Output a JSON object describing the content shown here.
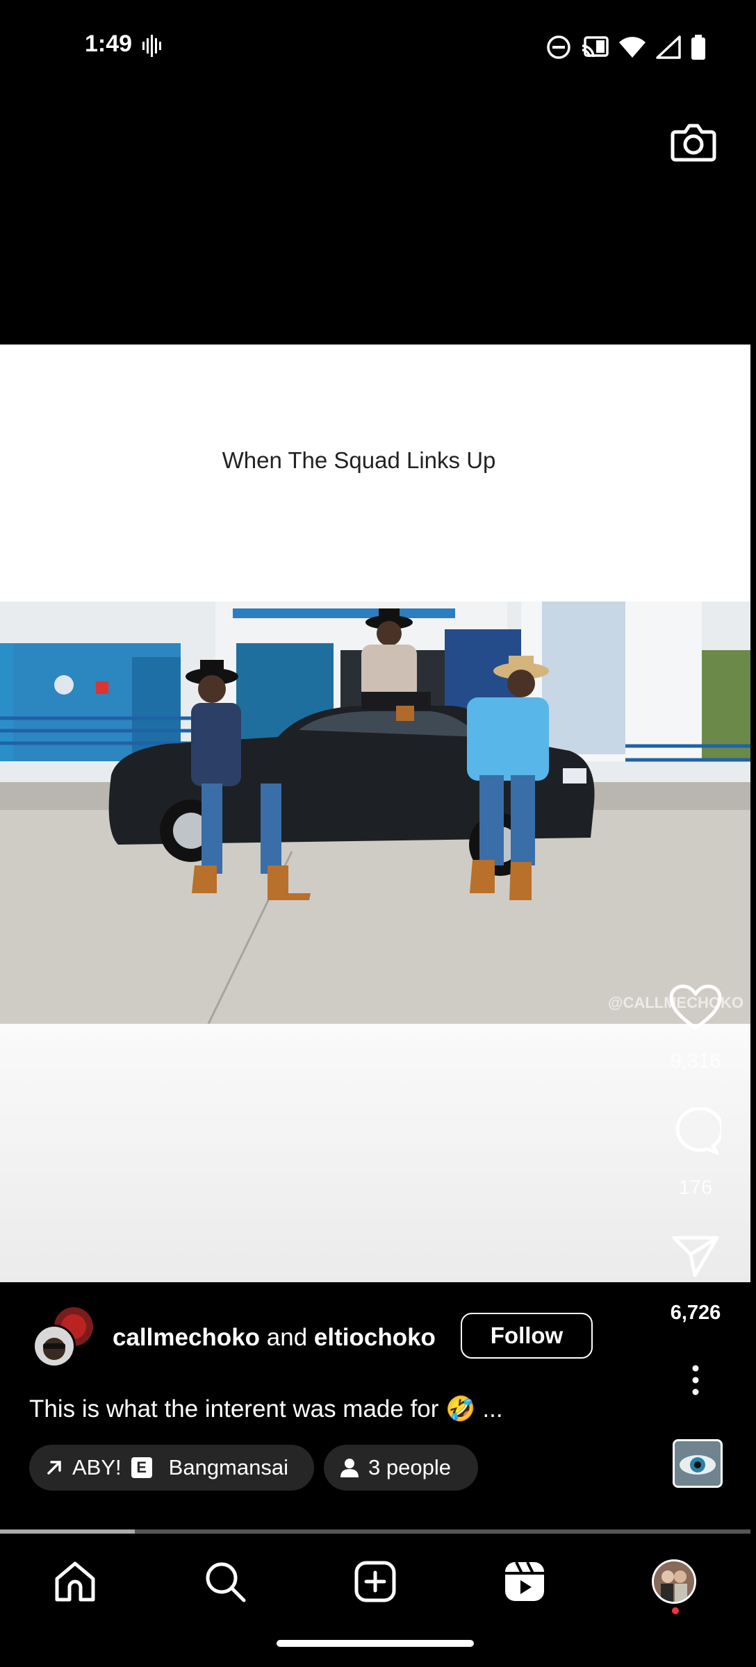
{
  "status_bar": {
    "time": "1:49"
  },
  "post": {
    "video_caption": "When The Squad Links Up",
    "watermark": "@CALLMECHOKO",
    "author_primary": "callmechoko",
    "author_joiner": "and",
    "author_secondary": "eltiochoko",
    "follow_label": "Follow",
    "caption": "This is what the interent was made for 🤣 ...",
    "music_track": "ABY!",
    "music_explicit": "E",
    "music_artist": "Bangmansai",
    "people_label": "3 people",
    "progress": 0.18
  },
  "actions": {
    "like_count": "9,316",
    "comment_count": "176",
    "share_count": "6,726"
  },
  "nav": {
    "items": [
      "home-icon",
      "search-icon",
      "create-icon",
      "reels-icon",
      "profile-avatar"
    ]
  },
  "colors": {
    "background": "#000000",
    "pill": "#262626",
    "notification": "#ff3040"
  }
}
